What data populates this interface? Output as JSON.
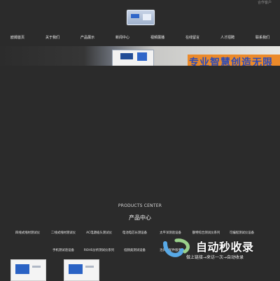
{
  "header": {
    "top_link": "合作客户"
  },
  "nav": {
    "items": [
      "欧姆首页",
      "关于我们",
      "产品展示",
      "新闻中心",
      "视频展播",
      "在线留言",
      "人才招聘",
      "联系我们"
    ]
  },
  "banner": {
    "slogan": "专业智慧创造无限"
  },
  "products": {
    "title_en": "PRODUCTS CENTER",
    "title_cn": "产品中心",
    "row1": [
      "四线式线材测试仪",
      "二线式线材测试仪",
      "AC电源插头测试仪",
      "电池电芯长测设备",
      "太平洋测验设备",
      "额特综合测试仪系列",
      "可编程测试仪设备"
    ],
    "row2": [
      "手机测试验设备",
      "ROHS分析测试仪系列",
      "低频类测试设备",
      "治具类配件服务"
    ]
  },
  "watermark": {
    "title": "自动秒收录",
    "subtitle": "做上链接→来访一次→自动收录"
  },
  "colors": {
    "background": "#2b2b2b",
    "slogan": "#2a4ab8",
    "slogan_bg": "#eb8a2a"
  }
}
